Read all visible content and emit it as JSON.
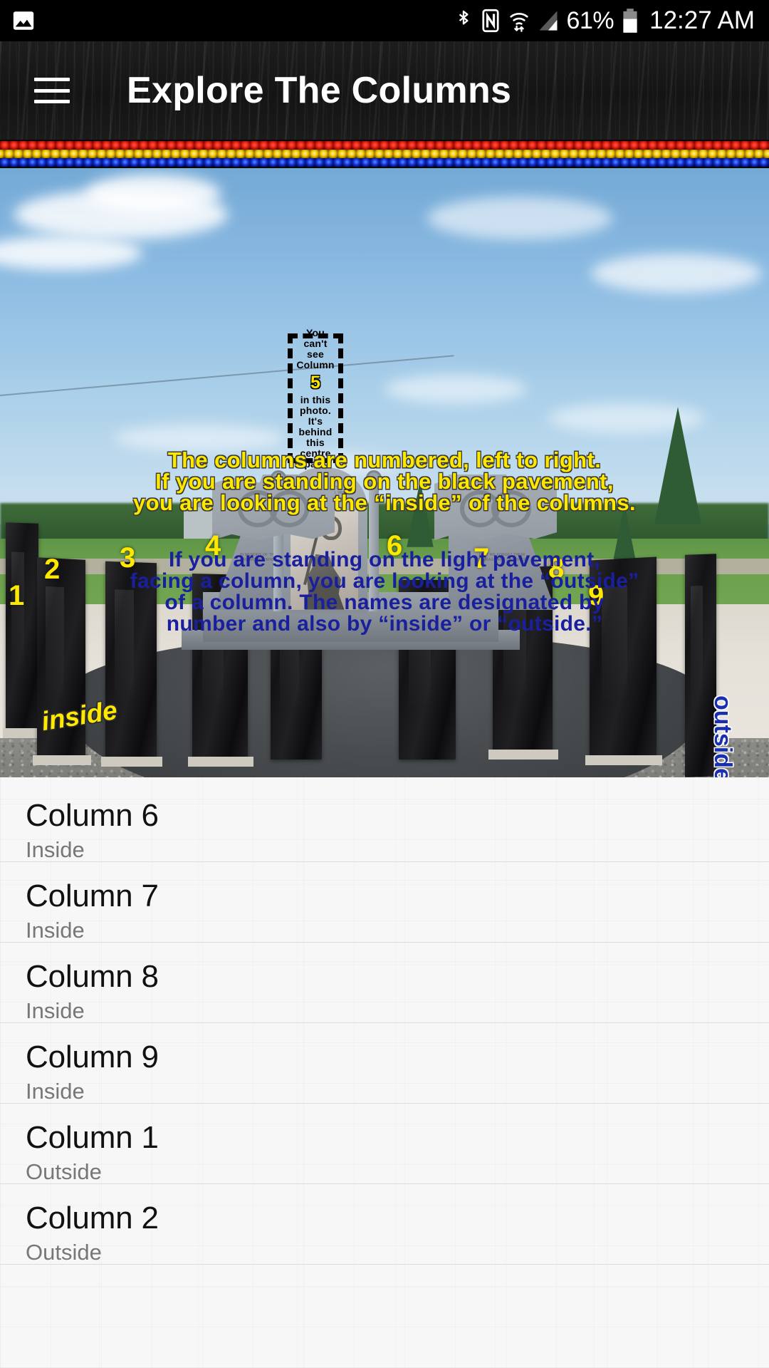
{
  "statusbar": {
    "image_icon": "picture-icon",
    "bluetooth_icon": "bluetooth-icon",
    "nfc_icon": "nfc-icon",
    "wifi_icon": "wifi-icon",
    "signal_icon": "cellular-signal-icon",
    "battery_percent": "61%",
    "battery_icon": "battery-icon",
    "clock": "12:27 AM"
  },
  "appbar": {
    "menu_icon": "hamburger-menu-icon",
    "title": "Explore The Columns"
  },
  "decor": {
    "bead_colors": [
      "#e81f10",
      "#f5c400",
      "#1030d8"
    ]
  },
  "photo": {
    "callout": {
      "line1": "You",
      "line2": "can't",
      "line3": "see",
      "line4": "Column",
      "number": "5",
      "line5": "in this",
      "line6": "photo.",
      "line7": "It's",
      "line8": "behind",
      "line9": "this",
      "line10": "centre",
      "line11": "part."
    },
    "column_numbers": [
      "1",
      "2",
      "3",
      "4",
      "6",
      "7",
      "8",
      "9"
    ],
    "tag_inside": "inside",
    "tag_outside": "outside",
    "caption_yellow": [
      "The columns are numbered, left to right.",
      "If you are standing on the black pavement,",
      "you are looking at the “inside” of the columns."
    ],
    "caption_blue": [
      "If you are standing on the light pavement,",
      "facing a column, you are looking at the “outside”",
      "of a column. The names are designated by",
      "number and also by “inside” or “outside.”"
    ],
    "monument": {
      "infinity_symbol": "metis-infinity-icon",
      "engraving_left": "IN MEMORY OF THOSE MEN AND WOMEN WHO SERVED",
      "engraving_right": "LEST WE FORGET THEIR COURAGE AND SACRIFICE",
      "engraving_top": "THIS MONUMENT IS DEDICATED TO ALL WHO SERVED"
    }
  },
  "list": {
    "rows": [
      {
        "title": "Column 6",
        "sub": "Inside"
      },
      {
        "title": "Column 7",
        "sub": "Inside"
      },
      {
        "title": "Column 8",
        "sub": "Inside"
      },
      {
        "title": "Column 9",
        "sub": "Inside"
      },
      {
        "title": "Column 1",
        "sub": "Outside"
      },
      {
        "title": "Column 2",
        "sub": "Outside"
      }
    ]
  }
}
